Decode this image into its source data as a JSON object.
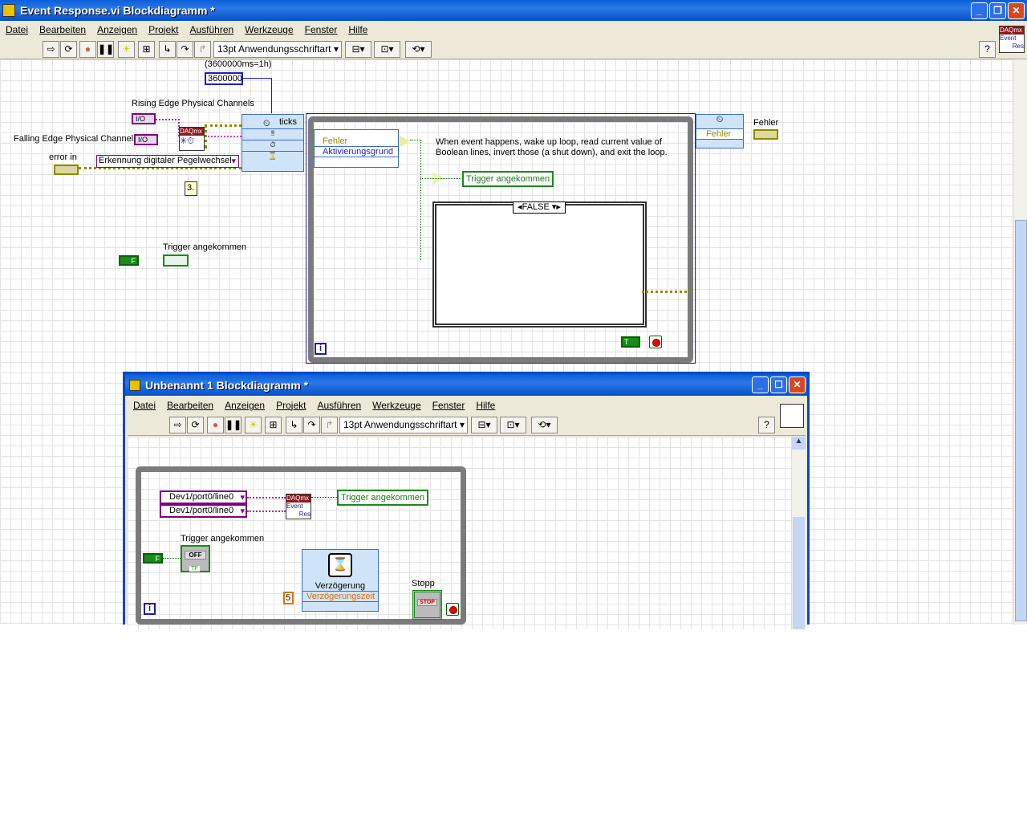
{
  "main_window": {
    "title": "Event Response.vi Blockdiagramm *",
    "menu": [
      "Datei",
      "Bearbeiten",
      "Anzeigen",
      "Projekt",
      "Ausführen",
      "Werkzeuge",
      "Fenster",
      "Hilfe"
    ],
    "font_select": "13pt Anwendungsschriftart",
    "help_label": "?",
    "daqmx_badge": [
      "DAQmx",
      "Event",
      "Res"
    ],
    "diagram": {
      "timeout_comment": "(3600000ms=1h)",
      "timeout_constant": "3600000",
      "rising_label": "Rising Edge Physical Channels",
      "falling_label": "Falling Edge Physical Channels",
      "io_const": "I/O",
      "error_in_label": "error in",
      "detection_enum": "Erkennung digitaler Pegelwechsel",
      "daqmx_node": "DAQmx",
      "step_label": "3.",
      "event_ticks": "ticks",
      "trigger_label": "Trigger angekommen",
      "event_data": [
        "Fehler",
        "Aktivierungsgrund"
      ],
      "comment": "When event happens, wake up loop, read current value of Boolean lines, invert those (a shut down), and exit the loop.",
      "trigger_indicator": "Trigger angekommen",
      "case_selector": "FALSE",
      "loop_index": "i",
      "out_error_terminal": "Fehler",
      "out_error_label": "Fehler",
      "true_const": "T",
      "false_const": "F"
    }
  },
  "sub_window": {
    "title": "Unbenannt 1 Blockdiagramm *",
    "menu": [
      "Datei",
      "Bearbeiten",
      "Anzeigen",
      "Projekt",
      "Ausführen",
      "Werkzeuge",
      "Fenster",
      "Hilfe"
    ],
    "font_select": "13pt Anwendungsschriftart",
    "help_label": "?",
    "diagram": {
      "channels": [
        "Dev1/port0/line0",
        "Dev1/port0/line0"
      ],
      "daqmx_node": [
        "DAQmx",
        "Event",
        "Res"
      ],
      "trigger_indicator": "Trigger angekommen",
      "trigger_label": "Trigger angekommen",
      "switch_text": "OFF",
      "false_const": "F",
      "delay_title": "Verzögerung",
      "delay_input": "Verzögerungszeit",
      "delay_value": "5",
      "stop_label": "Stopp",
      "stop_text": "STOP",
      "loop_index": "i",
      "tf": "TF"
    }
  }
}
